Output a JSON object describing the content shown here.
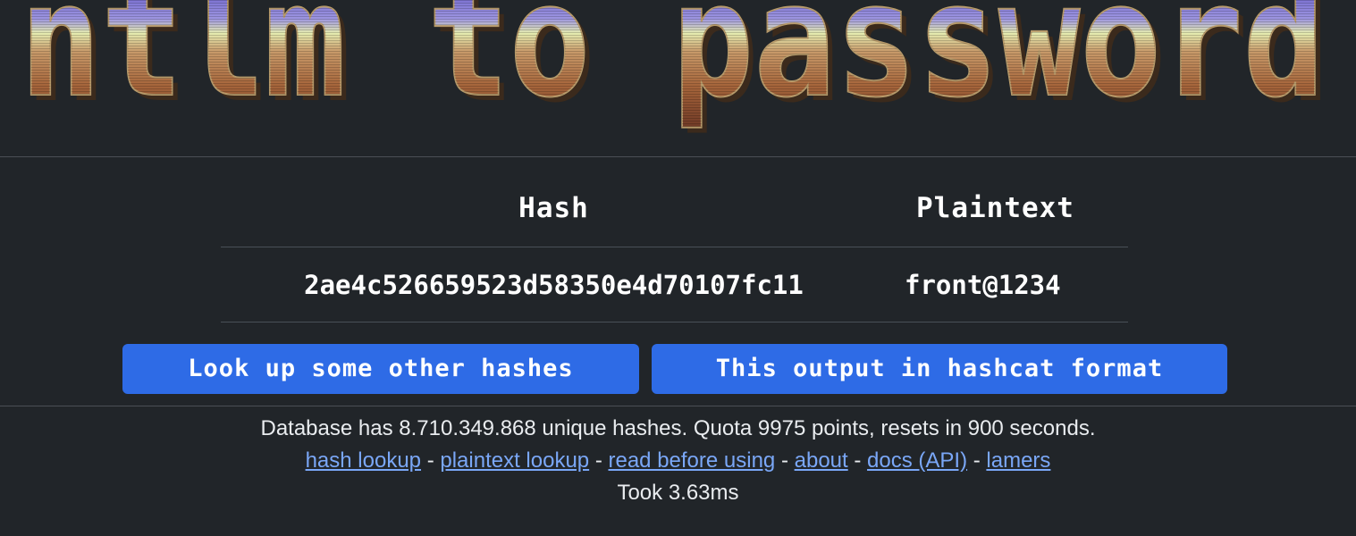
{
  "logo": {
    "text": "ntlm to password",
    "colors": {
      "top": "#3a2f9a",
      "upper": "#7a6fd0",
      "middle": "#e8ecb0",
      "lower": "#a06a3a",
      "bottom": "#7a3f2a",
      "outline": "#5a3f2a"
    }
  },
  "results": {
    "headers": {
      "hash": "Hash",
      "plaintext": "Plaintext"
    },
    "rows": [
      {
        "hash": "2ae4c526659523d58350e4d70107fc11",
        "plaintext": "front@1234"
      }
    ]
  },
  "buttons": {
    "lookup": "Look up some other hashes",
    "hashcat": "This output in hashcat format"
  },
  "footer": {
    "stats": "Database has 8.710.349.868 unique hashes. Quota 9975 points, resets in 900 seconds.",
    "links": [
      "hash lookup",
      "plaintext lookup",
      "read before using",
      "about",
      "docs (API)",
      "lamers"
    ],
    "separator": "-",
    "timing": "Took 3.63ms"
  },
  "theme": {
    "background": "#212529",
    "button": "#2e6be6",
    "link": "#7aa7f7"
  }
}
